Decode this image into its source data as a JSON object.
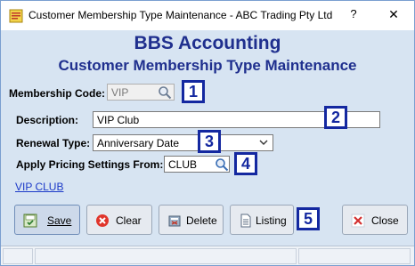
{
  "window": {
    "title": "Customer Membership Type Maintenance - ABC Trading Pty Ltd",
    "help_label": "?",
    "close_label": "✕"
  },
  "header": {
    "app_name": "BBS Accounting",
    "form_title": "Customer Membership Type Maintenance"
  },
  "form": {
    "membership_code": {
      "label": "Membership Code:",
      "value": "VIP"
    },
    "description": {
      "label": "Description:",
      "value": "VIP Club"
    },
    "renewal_type": {
      "label": "Renewal Type:",
      "value": "Anniversary Date"
    },
    "apply_pricing": {
      "label": "Apply Pricing Settings From:",
      "value": "CLUB"
    }
  },
  "link": {
    "text": "VIP CLUB"
  },
  "annotations": [
    "1",
    "2",
    "3",
    "4",
    "5"
  ],
  "buttons": {
    "save": "Save",
    "clear": "Clear",
    "delete": "Delete",
    "listing": "Listing",
    "close": "Close"
  },
  "colors": {
    "accent": "#1f2f8e",
    "badge": "#1428a0",
    "link": "#1a38c8",
    "background": "#d7e4f2"
  }
}
